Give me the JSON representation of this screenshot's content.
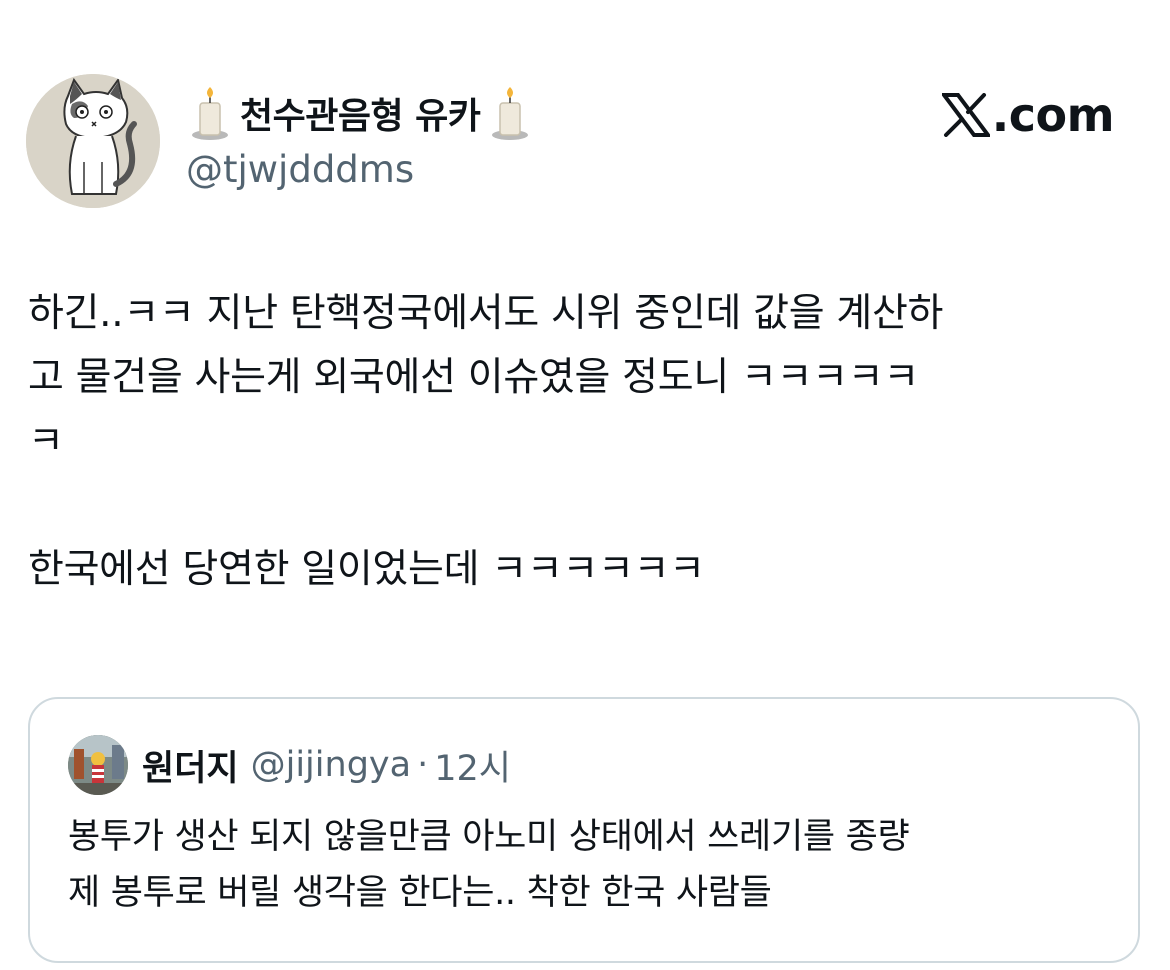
{
  "brand": {
    "label": ".com"
  },
  "author": {
    "display_name": "천수관음형 유카",
    "handle": "@tjwjdddms"
  },
  "tweet": {
    "lines": [
      "하긴..ㅋㅋ 지난 탄핵정국에서도 시위 중인데 값을 계산하",
      "고 물건을 사는게 외국에선 이슈였을 정도니 ㅋㅋㅋㅋㅋ",
      "ㅋ",
      "한국에선 당연한 일이었는데 ㅋㅋㅋㅋㅋㅋ"
    ]
  },
  "quote": {
    "name": "원더지",
    "handle": "@jijingya",
    "separator": "·",
    "time": "12시",
    "lines": [
      "봉투가 생산 되지 않을만큼 아노미 상태에서 쓰레기를 종량",
      "제 봉투로 버릴 생각을 한다는.. 착한 한국 사람들"
    ]
  },
  "colors": {
    "text": "#0f1419",
    "secondary": "#536471",
    "border": "#cfd9de"
  },
  "icons": {
    "avatar": "cat-drawing-avatar",
    "name_emoji": "candle-icon",
    "brand": "x-logo-icon"
  }
}
